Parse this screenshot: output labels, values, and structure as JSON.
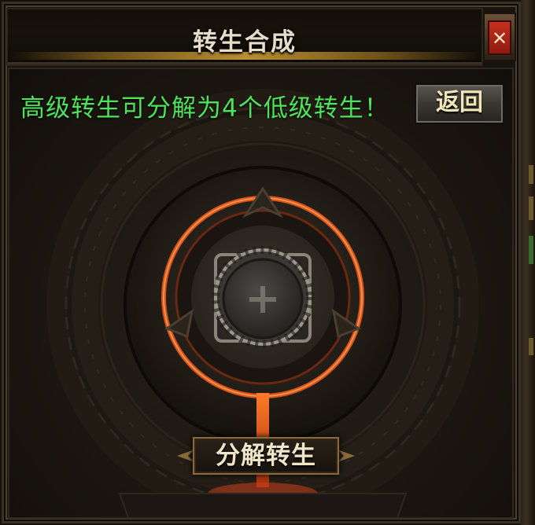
{
  "window": {
    "title": "转生合成",
    "close_icon": "close-icon"
  },
  "panel": {
    "hint": "高级转生可分解为4个低级转生！",
    "back_label": "返回",
    "slot_icon": "plus-icon",
    "decompose_label": "分解转生"
  },
  "colors": {
    "hint_text": "#4ee35a",
    "title_text": "#e6dcc8",
    "lava_glow": "#e2551c",
    "close_red": "#c7301f"
  }
}
